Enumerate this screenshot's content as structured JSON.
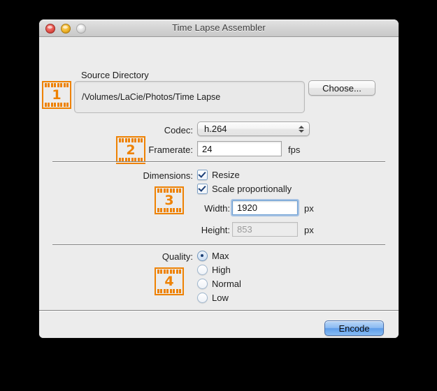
{
  "window": {
    "title": "Time Lapse Assembler",
    "traffic_lights": [
      "close-button",
      "minimize-button",
      "zoom-button"
    ]
  },
  "source": {
    "group_label": "Source Directory",
    "badge": "1",
    "path_value": "/Volumes/LaCie/Photos/Time Lapse",
    "choose_label": "Choose..."
  },
  "encoding": {
    "badge": "2",
    "codec_label": "Codec:",
    "codec_value": "h.264",
    "codec_options": [
      "h.264"
    ],
    "framerate_label": "Framerate:",
    "framerate_value": "24",
    "framerate_unit": "fps"
  },
  "dimensions": {
    "badge": "3",
    "label": "Dimensions:",
    "resize_label": "Resize",
    "resize_checked": true,
    "scale_label": "Scale proportionally",
    "scale_checked": true,
    "width_label": "Width:",
    "width_value": "1920",
    "width_unit": "px",
    "height_label": "Height:",
    "height_value": "853",
    "height_unit": "px"
  },
  "quality": {
    "badge": "4",
    "label": "Quality:",
    "options": [
      {
        "label": "Max",
        "selected": true
      },
      {
        "label": "High",
        "selected": false
      },
      {
        "label": "Normal",
        "selected": false
      },
      {
        "label": "Low",
        "selected": false
      }
    ]
  },
  "footer": {
    "encode_label": "Encode"
  },
  "colors": {
    "accent_orange": "#ee8203",
    "default_button_blue": "#5e9ce9",
    "window_bg": "#ececec",
    "focus_ring": "#6ea0dc"
  }
}
